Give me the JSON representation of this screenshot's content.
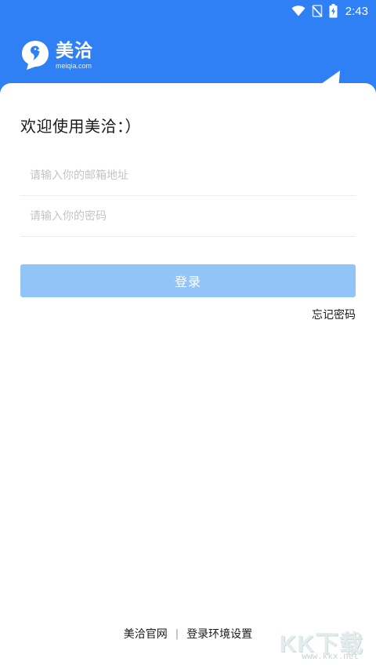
{
  "status_bar": {
    "time": "2:43",
    "icons": [
      "wifi-icon",
      "no-signal-icon",
      "battery-charging-icon"
    ]
  },
  "logo": {
    "name": "美洽",
    "domain": "meiqia.com"
  },
  "login": {
    "welcome": "欢迎使用美洽：）",
    "email_placeholder": "请输入你的邮箱地址",
    "password_placeholder": "请输入你的密码",
    "login_label": "登录",
    "forgot_label": "忘记密码"
  },
  "footer": {
    "official_site": "美洽官网",
    "separator": "|",
    "env_settings": "登录环境设置"
  },
  "watermark": {
    "title": "KK下载",
    "url": "www.kkx.net"
  },
  "colors": {
    "brand_blue": "#2f80f5",
    "button_disabled": "#92c4f8"
  }
}
